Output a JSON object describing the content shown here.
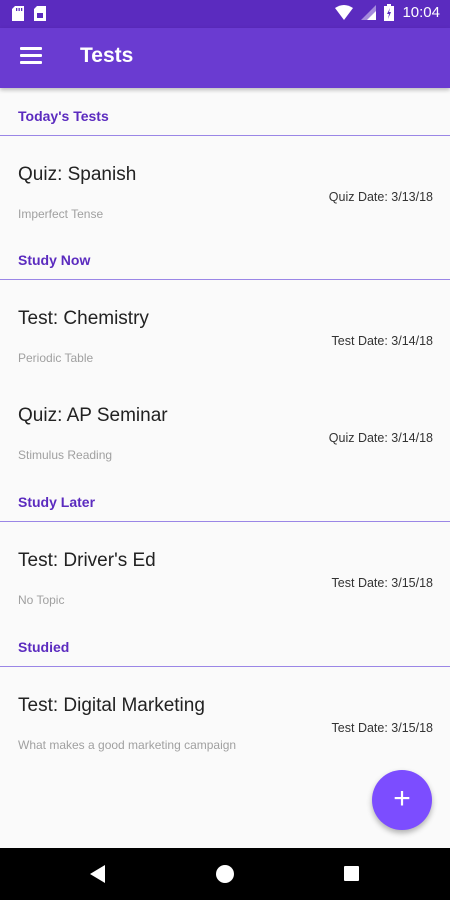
{
  "status_bar": {
    "time": "10:04",
    "left_icons": [
      "sd-card-icon",
      "sim-card-icon"
    ],
    "right_icons": [
      "wifi-icon",
      "signal-icon",
      "battery-icon"
    ]
  },
  "app_bar": {
    "title": "Tests",
    "menu_icon": "hamburger-menu-icon"
  },
  "sections": [
    {
      "header": "Today's Tests",
      "items": [
        {
          "title": "Quiz: Spanish",
          "subtitle": "Imperfect Tense",
          "date": "Quiz Date: 3/13/18"
        }
      ]
    },
    {
      "header": "Study Now",
      "items": [
        {
          "title": "Test: Chemistry",
          "subtitle": "Periodic Table",
          "date": "Test Date: 3/14/18"
        },
        {
          "title": "Quiz: AP Seminar",
          "subtitle": "Stimulus Reading",
          "date": "Quiz Date: 3/14/18"
        }
      ]
    },
    {
      "header": "Study Later",
      "items": [
        {
          "title": "Test: Driver's Ed",
          "subtitle": "No Topic",
          "date": "Test Date: 3/15/18"
        }
      ]
    },
    {
      "header": "Studied",
      "items": [
        {
          "title": "Test: Digital Marketing",
          "subtitle": "What makes a good marketing campaign",
          "date": "Test Date: 3/15/18"
        }
      ]
    }
  ],
  "fab": {
    "icon": "plus-icon",
    "label": "+"
  },
  "colors": {
    "primary": "#6a3bd1",
    "primary_dark": "#5b2bbf",
    "accent": "#7c4dff",
    "divider": "#9a86e6"
  }
}
